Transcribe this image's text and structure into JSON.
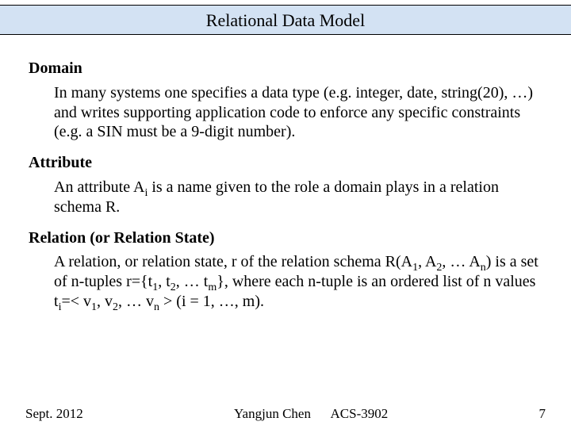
{
  "title": "Relational Data Model",
  "sections": {
    "domain": {
      "heading": "Domain",
      "body": "In many systems one specifies a data type (e.g. integer, date, string(20), …) and writes supporting application code to enforce any specific constraints (e.g. a SIN must be a 9-digit number)."
    },
    "attribute": {
      "heading": "Attribute",
      "body_html": "An attribute A<sub>i</sub> is a name given to the role a domain plays in a relation schema R."
    },
    "relation": {
      "heading": "Relation (or Relation State)",
      "body_html": "A relation, or relation state, r of the relation schema R(A<sub>1</sub>, A<sub>2</sub>, … A<sub>n</sub>) is a set of n-tuples r={t<sub>1</sub>, t<sub>2</sub>, … t<sub>m</sub>}, where each n-tuple is an ordered list of n values t<sub>i</sub>=&lt; v<sub>1</sub>, v<sub>2</sub>, … v<sub>n</sub> &gt; (i = 1, …, m)."
    }
  },
  "footer": {
    "date": "Sept. 2012",
    "author": "Yangjun Chen",
    "course": "ACS-3902",
    "page": "7"
  }
}
